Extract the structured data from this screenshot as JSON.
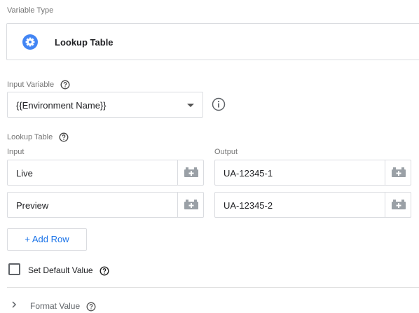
{
  "variable_type": {
    "section_label": "Variable Type",
    "selected_type": "Lookup Table",
    "icon": "gear-icon",
    "accent_color": "#4285f4"
  },
  "input_variable": {
    "label": "Input Variable",
    "value": "{{Environment Name}}"
  },
  "lookup_table": {
    "label": "Lookup Table",
    "input_header": "Input",
    "output_header": "Output",
    "rows": [
      {
        "input": "Live",
        "output": "UA-12345-1"
      },
      {
        "input": "Preview",
        "output": "UA-12345-2"
      }
    ],
    "add_row_label": "+ Add Row"
  },
  "default_value": {
    "label": "Set Default Value",
    "checked": false
  },
  "format_value": {
    "label": "Format Value",
    "expanded": false
  }
}
